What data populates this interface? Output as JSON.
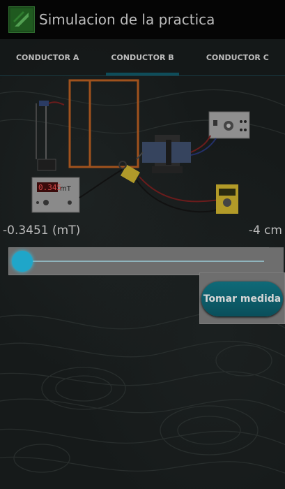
{
  "app": {
    "title": "Simulacion de la practica",
    "icon": "app-logo-icon"
  },
  "tabs": [
    {
      "label": "CONDUCTOR A",
      "active": false
    },
    {
      "label": "CONDUCTOR B",
      "active": true
    },
    {
      "label": "CONDUCTOR C",
      "active": false
    }
  ],
  "scene": {
    "meter_display": "0.345",
    "meter_unit": "mT"
  },
  "readouts": {
    "field": "-0.3451 (mT)",
    "distance": "-4 cm"
  },
  "slider": {
    "position": 0.0
  },
  "actions": {
    "measure_label": "Tomar medida"
  },
  "colors": {
    "accent": "#0f6a78",
    "slider_thumb": "#1fa6c9",
    "conductor": "#a0521d"
  }
}
